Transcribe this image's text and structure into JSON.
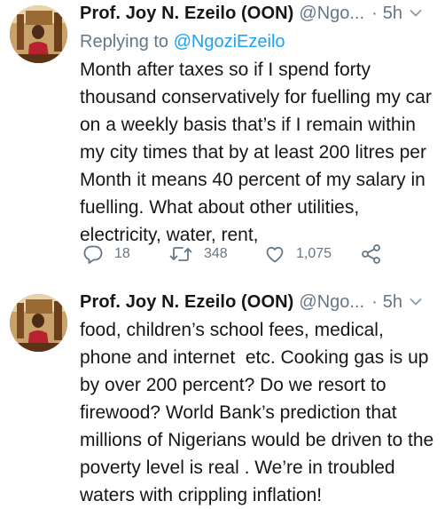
{
  "tweets": [
    {
      "author_name": "Prof. Joy N. Ezeilo (OON)",
      "handle": "@Ngo...",
      "separator": "·",
      "time": "5h",
      "reply_prefix": "Replying to ",
      "reply_mention": "@NgoziEzeilo",
      "text": "Month after taxes so if I spend forty thousand conservatively for fuelling my car on a weekly basis that’s if I remain within my city times that by at least 200 litres per Month it means 40 percent of my salary in fuelling. What about other utilities, electricity, water, rent,",
      "actions": {
        "reply_count": "18",
        "retweet_count": "348",
        "like_count": "1,075"
      },
      "icons": [
        "avatar",
        "chevron-down-icon",
        "reply-icon",
        "retweet-icon",
        "like-icon",
        "share-icon"
      ]
    },
    {
      "author_name": "Prof. Joy N. Ezeilo (OON)",
      "handle": "@Ngo...",
      "separator": "·",
      "time": "5h",
      "text": "food, children’s school fees, medical, phone and internet  etc. Cooking gas is up by over 200 percent? Do we resort to firewood? World Bank’s prediction that millions of Nigerians would be driven to the poverty level is real . We’re in troubled waters with crippling inflation!",
      "icons": [
        "avatar",
        "chevron-down-icon"
      ]
    }
  ],
  "colors": {
    "text": "#14171a",
    "secondary": "#657786",
    "link": "#1da1f2",
    "background": "#ffffff"
  }
}
